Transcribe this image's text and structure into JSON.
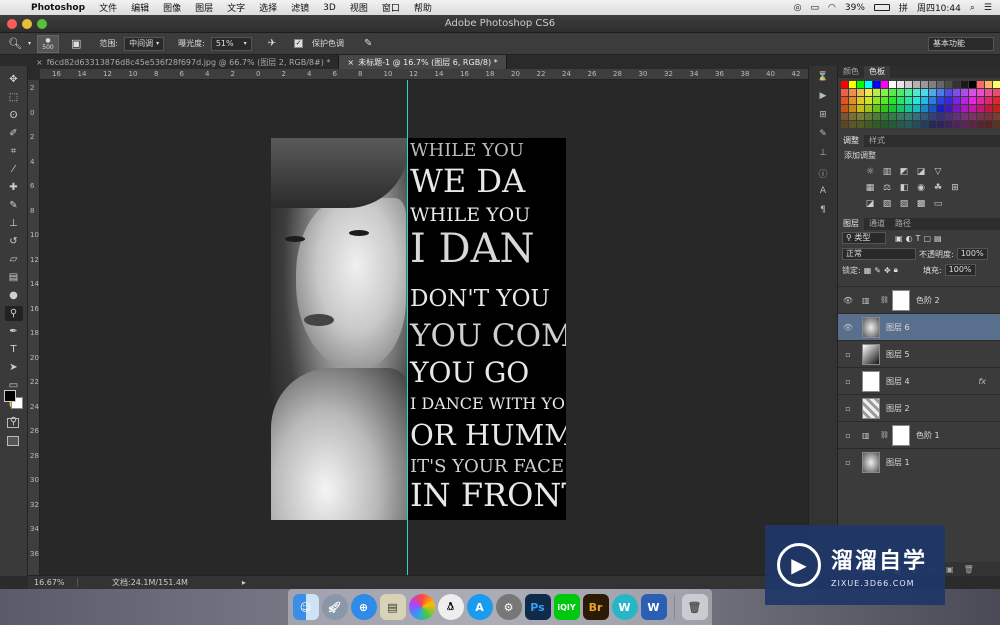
{
  "menubar": {
    "app_name": "Photoshop",
    "items": [
      "文件",
      "编辑",
      "图像",
      "图层",
      "文字",
      "选择",
      "滤镜",
      "3D",
      "视图",
      "窗口",
      "帮助"
    ],
    "battery": "39%",
    "clock": "周四10:44"
  },
  "window": {
    "title": "Adobe Photoshop CS6"
  },
  "options": {
    "brush_size": "500",
    "range_label": "范围:",
    "range_value": "中间调",
    "exposure_label": "曝光度:",
    "exposure_value": "51%",
    "protect_tones_label": "保护色调",
    "protect_tones_checked": true,
    "workspace": "基本功能"
  },
  "doc_tabs": [
    {
      "label": "f6cd82d63313876d8c45e536f28f697d.jpg @ 66.7% (图层 2, RGB/8#) *",
      "active": false
    },
    {
      "label": "未标题-1 @ 16.7% (图层 6, RGB/8) *",
      "active": true
    }
  ],
  "ruler": {
    "h_labels": [
      "16",
      "14",
      "12",
      "10",
      "8",
      "6",
      "4",
      "2",
      "0",
      "2",
      "4",
      "6",
      "8",
      "10",
      "12",
      "14",
      "16",
      "18",
      "20",
      "22",
      "24",
      "26",
      "28",
      "30",
      "32",
      "34",
      "36",
      "38",
      "40",
      "42"
    ],
    "v_labels": [
      "2",
      "0",
      "2",
      "4",
      "6",
      "8",
      "10",
      "12",
      "14",
      "16",
      "18",
      "20",
      "22",
      "24",
      "26",
      "28",
      "30",
      "32",
      "34",
      "36"
    ]
  },
  "artwork": {
    "lyrics": [
      "While you",
      "We da",
      "While you",
      "I dan",
      "Don't you",
      "You com",
      "You go",
      "I dance with yo",
      "Or humm",
      "It's your face",
      "In front"
    ]
  },
  "status": {
    "zoom": "16.67%",
    "doc_size": "文档:24.1M/151.4M"
  },
  "panels": {
    "swatch_tabs": [
      "颜色",
      "色板"
    ],
    "adjust_tabs": [
      "调整",
      "样式"
    ],
    "adjust_title": "添加调整",
    "layer_tabs": [
      "图层",
      "通道",
      "路径"
    ],
    "filter_kind": "类型",
    "blend_mode": "正常",
    "opacity_label": "不透明度:",
    "opacity_value": "100%",
    "lock_label": "锁定:",
    "fill_label": "填充:",
    "fill_value": "100%",
    "layers": [
      {
        "name": "色阶 2",
        "visible": true,
        "selected": false,
        "thumb": "adjust"
      },
      {
        "name": "图层 6",
        "visible": true,
        "selected": true,
        "thumb": "portrait"
      },
      {
        "name": "图层 5",
        "visible": false,
        "selected": false,
        "thumb": "dark"
      },
      {
        "name": "图层 4",
        "visible": false,
        "selected": false,
        "thumb": "white",
        "fx": "fx"
      },
      {
        "name": "图层 2",
        "visible": false,
        "selected": false,
        "thumb": "checker"
      },
      {
        "name": "色阶 1",
        "visible": false,
        "selected": false,
        "thumb": "adjust"
      },
      {
        "name": "图层 1",
        "visible": false,
        "selected": false,
        "thumb": "portrait"
      }
    ]
  },
  "watermark": {
    "title": "溜溜自学",
    "url": "ZIXUE.3D66.COM"
  },
  "dock": [
    "Finder",
    "Launchpad",
    "Safari",
    "Preview",
    "Photos",
    "QQ",
    "App Store",
    "System Preferences",
    "Ps",
    "iQIYI",
    "Br",
    "Wunderlist",
    "Word",
    "Trash"
  ],
  "colors": {
    "guide": "#2ad4d4",
    "selected_layer": "#58708e",
    "watermark_bg": "#1e3769"
  }
}
